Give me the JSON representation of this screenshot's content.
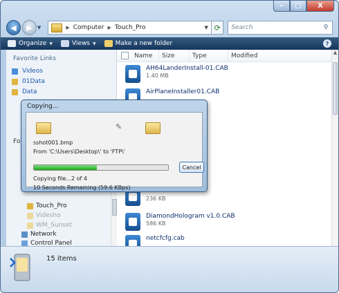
{
  "window": {
    "caption_buttons": {
      "minimize": "–",
      "maximize": "□",
      "close": "X"
    }
  },
  "nav": {
    "back_icon": "back-arrow-icon",
    "forward_icon": "forward-arrow-icon",
    "address": {
      "root": "Computer",
      "current": "Touch_Pro"
    },
    "search_placeholder": "Search"
  },
  "toolbar": {
    "organize": "Organize",
    "views": "Views",
    "new_folder": "Make a new folder",
    "help": "?"
  },
  "navpane": {
    "favorites_title": "Favorite Links",
    "favorites": [
      {
        "label": "Videos",
        "color": "#4a8dd8"
      },
      {
        "label": "01Data",
        "color": "#e0b440"
      },
      {
        "label": "Data",
        "color": "#e0b440"
      }
    ],
    "folders_label": "Fold",
    "tree": [
      {
        "label": "Touch_Pro",
        "dim": false
      },
      {
        "label": "Videsho",
        "dim": true
      },
      {
        "label": "WM_Sunset",
        "dim": true
      },
      {
        "label": "Network",
        "dim": false
      },
      {
        "label": "Control Panel",
        "dim": false
      }
    ]
  },
  "filepane": {
    "columns": [
      "Name",
      "Size",
      "Type",
      "Modified"
    ],
    "files": [
      {
        "name": "AH64LanderInstall-01.CAB",
        "size": "1.40 MB"
      },
      {
        "name": "AirPlaneInstaller01.CAB",
        "size": ""
      },
      {
        "name": "DiamondHologram v1.0.CAB",
        "size": "586 KB"
      },
      {
        "name": "netcfcfg.cab",
        "size": ""
      }
    ],
    "partial_size": "236 KB"
  },
  "details": {
    "count": "15 items"
  },
  "dialog": {
    "title": "Copying...",
    "filename": "sshot001.bmp",
    "from_to": "From 'C:\\Users\\Desktop\\' to 'FTP\\'",
    "status": "Copying file...2 of 4",
    "remaining": "10 Seconds Remaining (59.6 KBps)",
    "progress": 0.47,
    "cancel_label": "Cancel",
    "progress_color": "#1ca51c"
  }
}
